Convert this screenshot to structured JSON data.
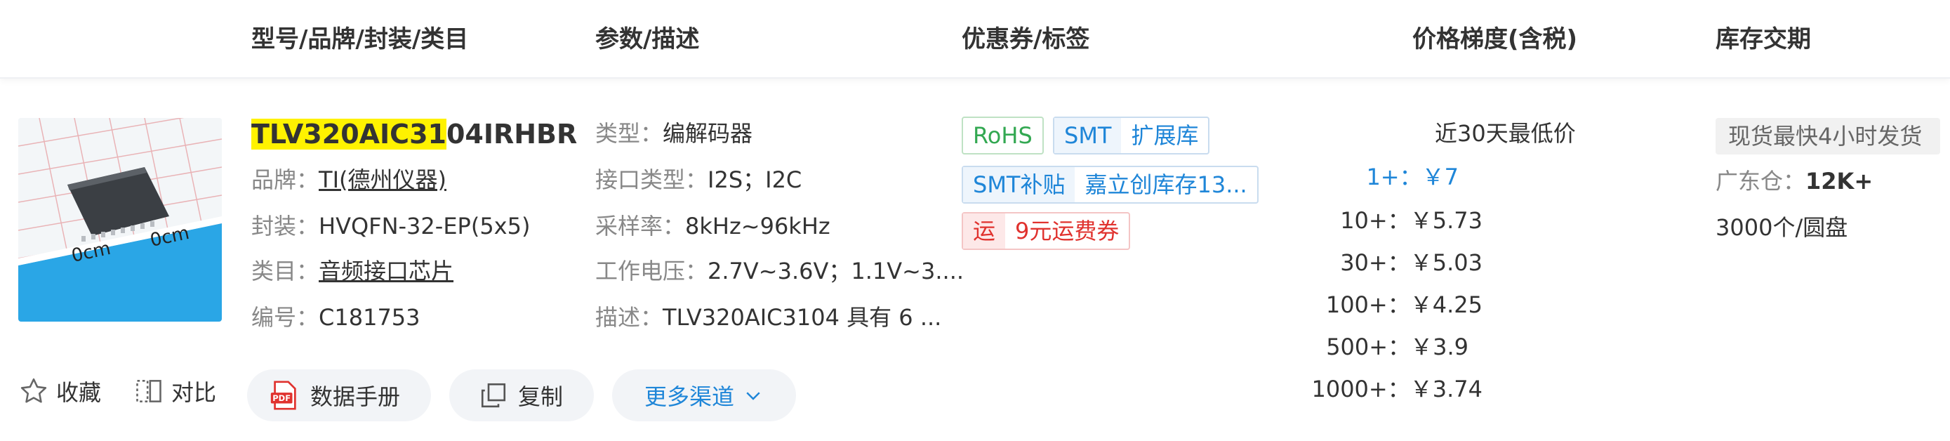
{
  "header": {
    "col_model": "型号/品牌/封装/类目",
    "col_params": "参数/描述",
    "col_coupon": "优惠券/标签",
    "col_price": "价格梯度(含税)",
    "col_stock": "库存交期"
  },
  "product": {
    "part_highlight": "TLV320AIC31",
    "part_rest": "04IRHBR",
    "brand_label": "品牌：",
    "brand_value": "TI(德州仪器)",
    "package_label": "封装：",
    "package_value": "HVQFN-32-EP(5x5)",
    "category_label": "类目：",
    "category_value": "音频接口芯片",
    "code_label": "编号：",
    "code_value": "C181753",
    "image_ruler_left": "0cm",
    "image_ruler_right": "0cm"
  },
  "params": {
    "type_label": "类型：",
    "type_value": "编解码器",
    "interface_label": "接口类型：",
    "interface_value": "I2S；I2C",
    "sample_label": "采样率：",
    "sample_value": "8kHz~96kHz",
    "voltage_label": "工作电压：",
    "voltage_value": "2.7V~3.6V；1.1V~3....",
    "desc_label": "描述：",
    "desc_value": "TLV320AIC3104 具有 6 ..."
  },
  "tags": {
    "rohs": "RoHS",
    "smt": "SMT",
    "smt_ext": "扩展库",
    "smt_supp": "SMT补贴",
    "smt_supp_text": "嘉立创库存13...",
    "freight_icon": "运",
    "freight_text": "9元运费券"
  },
  "price": {
    "title": "近30天最低价",
    "tiers": [
      {
        "qty": "1+：",
        "price": "￥7"
      },
      {
        "qty": "10+：",
        "price": "￥5.73"
      },
      {
        "qty": "30+：",
        "price": "￥5.03"
      },
      {
        "qty": "100+：",
        "price": "￥4.25"
      },
      {
        "qty": "500+：",
        "price": "￥3.9"
      },
      {
        "qty": "1000+：",
        "price": "￥3.74"
      }
    ]
  },
  "stock": {
    "badge": "现货最快4小时发货",
    "warehouse_label": "广东仓：",
    "warehouse_value": "12K+",
    "packaging": "3000个/圆盘"
  },
  "actions": {
    "favorite": "收藏",
    "compare": "对比",
    "datasheet": "数据手册",
    "datasheet_icon_text": "PDF",
    "copy": "复制",
    "more_channels": "更多渠道"
  },
  "colors": {
    "accent_blue": "#1f86d8",
    "rohs_green": "#33a852",
    "freight_red": "#e0322e",
    "highlight_yellow": "#fff200"
  }
}
